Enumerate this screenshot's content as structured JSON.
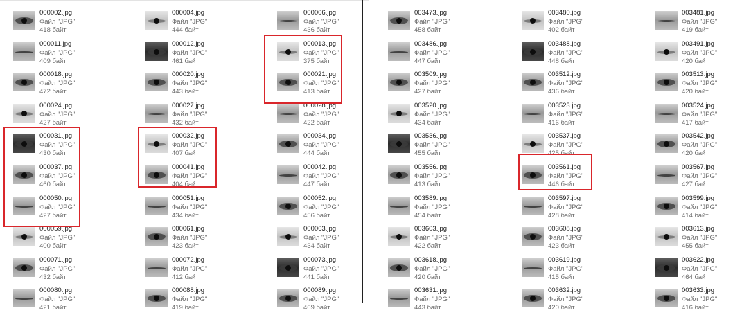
{
  "left_panel": {
    "columns": [
      [
        {
          "name": "000002.jpg",
          "type": "Файл \"JPG\"",
          "size": "418 байт"
        },
        {
          "name": "000011.jpg",
          "type": "Файл \"JPG\"",
          "size": "409 байт"
        },
        {
          "name": "000018.jpg",
          "type": "Файл \"JPG\"",
          "size": "472 байт"
        },
        {
          "name": "000024.jpg",
          "type": "Файл \"JPG\"",
          "size": "427 байт"
        },
        {
          "name": "000031.jpg",
          "type": "Файл \"JPG\"",
          "size": "430 байт"
        },
        {
          "name": "000037.jpg",
          "type": "Файл \"JPG\"",
          "size": "460 байт"
        },
        {
          "name": "000050.jpg",
          "type": "Файл \"JPG\"",
          "size": "427 байт"
        },
        {
          "name": "000059.jpg",
          "type": "Файл \"JPG\"",
          "size": "400 байт"
        },
        {
          "name": "000071.jpg",
          "type": "Файл \"JPG\"",
          "size": "432 байт"
        },
        {
          "name": "000080.jpg",
          "type": "Файл \"JPG\"",
          "size": "421 байт"
        }
      ],
      [
        {
          "name": "000004.jpg",
          "type": "Файл \"JPG\"",
          "size": "444 байт"
        },
        {
          "name": "000012.jpg",
          "type": "Файл \"JPG\"",
          "size": "461 байт"
        },
        {
          "name": "000020.jpg",
          "type": "Файл \"JPG\"",
          "size": "443 байт"
        },
        {
          "name": "000027.jpg",
          "type": "Файл \"JPG\"",
          "size": "432 байт"
        },
        {
          "name": "000032.jpg",
          "type": "Файл \"JPG\"",
          "size": "407 байт"
        },
        {
          "name": "000041.jpg",
          "type": "Файл \"JPG\"",
          "size": "404 байт"
        },
        {
          "name": "000051.jpg",
          "type": "Файл \"JPG\"",
          "size": "434 байт"
        },
        {
          "name": "000061.jpg",
          "type": "Файл \"JPG\"",
          "size": "423 байт"
        },
        {
          "name": "000072.jpg",
          "type": "Файл \"JPG\"",
          "size": "412 байт"
        },
        {
          "name": "000088.jpg",
          "type": "Файл \"JPG\"",
          "size": "419 байт"
        }
      ],
      [
        {
          "name": "000006.jpg",
          "type": "Файл \"JPG\"",
          "size": "436 байт"
        },
        {
          "name": "000013.jpg",
          "type": "Файл \"JPG\"",
          "size": "375 байт"
        },
        {
          "name": "000021.jpg",
          "type": "Файл \"JPG\"",
          "size": "413 байт"
        },
        {
          "name": "000028.jpg",
          "type": "Файл \"JPG\"",
          "size": "422 байт"
        },
        {
          "name": "000034.jpg",
          "type": "Файл \"JPG\"",
          "size": "444 байт"
        },
        {
          "name": "000042.jpg",
          "type": "Файл \"JPG\"",
          "size": "447 байт"
        },
        {
          "name": "000052.jpg",
          "type": "Файл \"JPG\"",
          "size": "456 байт"
        },
        {
          "name": "000063.jpg",
          "type": "Файл \"JPG\"",
          "size": "434 байт"
        },
        {
          "name": "000073.jpg",
          "type": "Файл \"JPG\"",
          "size": "441 байт"
        },
        {
          "name": "000089.jpg",
          "type": "Файл \"JPG\"",
          "size": "469 байт"
        }
      ]
    ]
  },
  "right_panel": {
    "columns": [
      [
        {
          "name": "003473.jpg",
          "type": "Файл \"JPG\"",
          "size": "458 байт"
        },
        {
          "name": "003486.jpg",
          "type": "Файл \"JPG\"",
          "size": "447 байт"
        },
        {
          "name": "003509.jpg",
          "type": "Файл \"JPG\"",
          "size": "427 байт"
        },
        {
          "name": "003520.jpg",
          "type": "Файл \"JPG\"",
          "size": "434 байт"
        },
        {
          "name": "003536.jpg",
          "type": "Файл \"JPG\"",
          "size": "455 байт"
        },
        {
          "name": "003556.jpg",
          "type": "Файл \"JPG\"",
          "size": "413 байт"
        },
        {
          "name": "003589.jpg",
          "type": "Файл \"JPG\"",
          "size": "454 байт"
        },
        {
          "name": "003603.jpg",
          "type": "Файл \"JPG\"",
          "size": "422 байт"
        },
        {
          "name": "003618.jpg",
          "type": "Файл \"JPG\"",
          "size": "420 байт"
        },
        {
          "name": "003631.jpg",
          "type": "Файл \"JPG\"",
          "size": "443 байт"
        }
      ],
      [
        {
          "name": "003480.jpg",
          "type": "Файл \"JPG\"",
          "size": "402 байт"
        },
        {
          "name": "003488.jpg",
          "type": "Файл \"JPG\"",
          "size": "448 байт"
        },
        {
          "name": "003512.jpg",
          "type": "Файл \"JPG\"",
          "size": "436 байт"
        },
        {
          "name": "003523.jpg",
          "type": "Файл \"JPG\"",
          "size": "416 байт"
        },
        {
          "name": "003537.jpg",
          "type": "Файл \"JPG\"",
          "size": "425 байт"
        },
        {
          "name": "003561.jpg",
          "type": "Файл \"JPG\"",
          "size": "446 байт"
        },
        {
          "name": "003597.jpg",
          "type": "Файл \"JPG\"",
          "size": "428 байт"
        },
        {
          "name": "003608.jpg",
          "type": "Файл \"JPG\"",
          "size": "423 байт"
        },
        {
          "name": "003619.jpg",
          "type": "Файл \"JPG\"",
          "size": "415 байт"
        },
        {
          "name": "003632.jpg",
          "type": "Файл \"JPG\"",
          "size": "420 байт"
        }
      ],
      [
        {
          "name": "003481.jpg",
          "type": "Файл \"JPG\"",
          "size": "419 байт"
        },
        {
          "name": "003491.jpg",
          "type": "Файл \"JPG\"",
          "size": "420 байт"
        },
        {
          "name": "003513.jpg",
          "type": "Файл \"JPG\"",
          "size": "420 байт"
        },
        {
          "name": "003524.jpg",
          "type": "Файл \"JPG\"",
          "size": "417 байт"
        },
        {
          "name": "003542.jpg",
          "type": "Файл \"JPG\"",
          "size": "420 байт"
        },
        {
          "name": "003567.jpg",
          "type": "Файл \"JPG\"",
          "size": "427 байт"
        },
        {
          "name": "003599.jpg",
          "type": "Файл \"JPG\"",
          "size": "414 байт"
        },
        {
          "name": "003613.jpg",
          "type": "Файл \"JPG\"",
          "size": "455 байт"
        },
        {
          "name": "003622.jpg",
          "type": "Файл \"JPG\"",
          "size": "464 байт"
        },
        {
          "name": "003633.jpg",
          "type": "Файл \"JPG\"",
          "size": "416 байт"
        }
      ]
    ]
  },
  "thumbnail_icon": "eye-photo-thumbnail-icon",
  "colors": {
    "highlight": "#d9262b",
    "divider": "#202020",
    "name_text": "#1a1a1a",
    "meta_text": "#6b6b6b"
  }
}
